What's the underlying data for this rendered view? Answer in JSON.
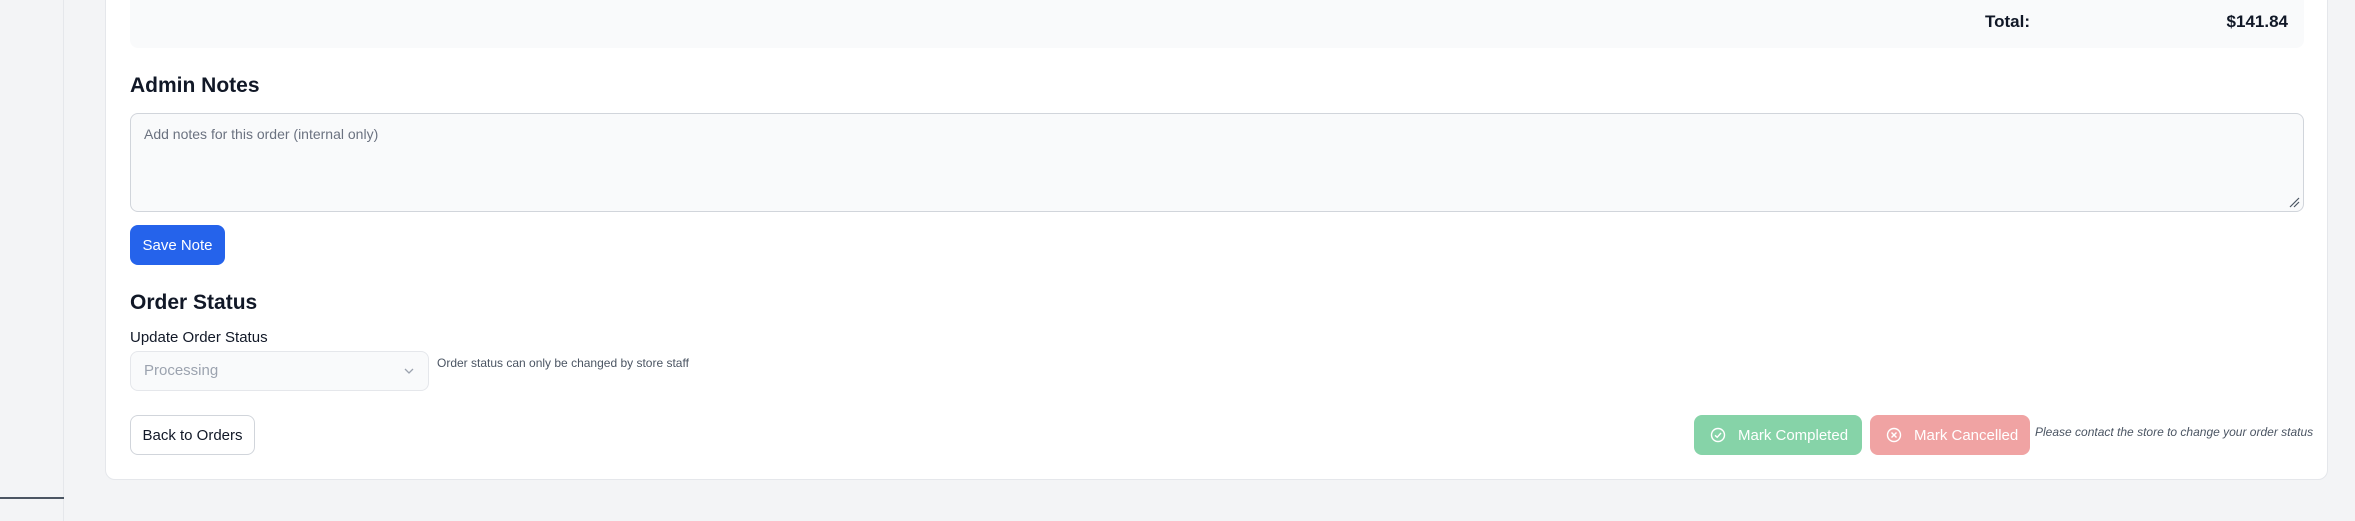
{
  "totals": {
    "label": "Total:",
    "value": "$141.84"
  },
  "admin_notes": {
    "title": "Admin Notes",
    "placeholder": "Add notes for this order (internal only)",
    "value": "",
    "save_label": "Save Note"
  },
  "order_status": {
    "title": "Order Status",
    "field_label": "Update Order Status",
    "selected": "Processing",
    "hint": "Order status can only be changed by store staff"
  },
  "actions": {
    "back_label": "Back to Orders",
    "completed_label": "Mark Completed",
    "cancelled_label": "Mark Cancelled",
    "contact_note": "Please contact the store to change your order status"
  },
  "colors": {
    "primary": "#2563eb",
    "success_disabled": "#86d3a8",
    "danger_disabled": "#f0a3a3"
  },
  "icons": {
    "completed": "check-circle-icon",
    "cancelled": "x-circle-icon",
    "select": "chevron-down-icon"
  }
}
